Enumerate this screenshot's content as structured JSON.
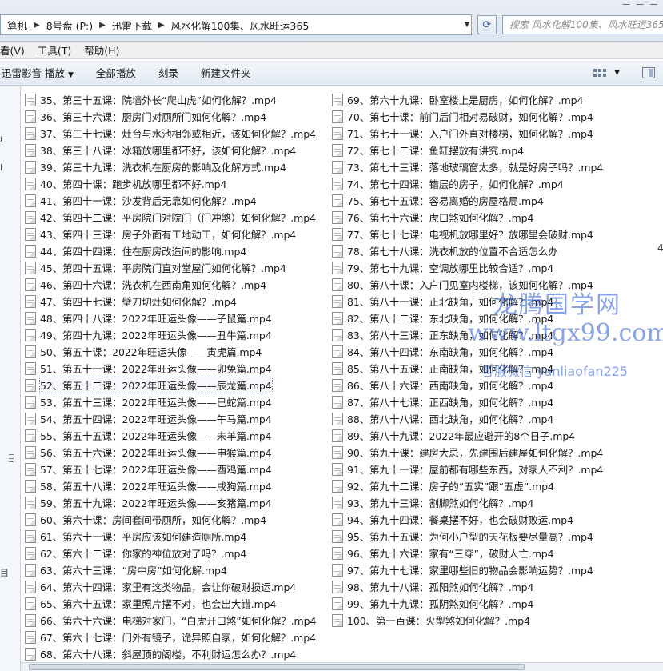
{
  "address_bar": {
    "crumbs": [
      "算机",
      "8号盘 (P:)",
      "迅雷下载",
      "风水化解100集、风水旺运365"
    ],
    "search_placeholder": "搜索 风水化解100集、风水旺运365"
  },
  "menu": [
    "看(V)",
    "工具(T)",
    "帮助(H)"
  ],
  "toolbar": {
    "buttons": [
      "迅雷影音 播放",
      "全部播放",
      "刻录",
      "新建文件夹"
    ]
  },
  "nav_glyphs": [
    "t",
    "I",
    "目"
  ],
  "files_left": [
    "35、第三十五课：院墙外长“爬山虎”如何化解？.mp4",
    "36、第三十六课：厨房门对厕所门如何化解？.mp4",
    "37、第三十七课：灶台与水池相邻或相近，该如何化解？.mp4",
    "38、第三十八课：冰箱放哪里都不好，该如何化解？.mp4",
    "39、第三十九课：洗衣机在厨房的影响及化解方式.mp4",
    "40、第四十课：跑步机放哪里都不好.mp4",
    "41、第四十一课：沙发背后无靠如何化解？.mp4",
    "42、第四十二课：平房院门对院门（门冲煞）如何化解？.mp4",
    "43、第四十三课：房子外面有工地动工，如何化解？.mp4",
    "44、第四十四课：住在厨房改造间的影响.mp4",
    "45、第四十五课：平房院门直对堂屋门如何化解？.mp4",
    "46、第四十六课：洗衣机在西南角如何化解？.mp4",
    "47、第四十七课：壁刀切灶如何化解？.mp4",
    "48、第四十八课：2022年旺运头像——子鼠篇.mp4",
    "49、第四十九课：2022年旺运头像——丑牛篇.mp4",
    "50、第五十课：2022年旺运头像——寅虎篇.mp4",
    "51、第五十一课：2022年旺运头像——卯兔篇.mp4",
    "52、第五十二课：2022年旺运头像——辰龙篇.mp4",
    "53、第五十三课：2022年旺运头像——巳蛇篇.mp4",
    "54、第五十四课：2022年旺运头像——午马篇.mp4",
    "55、第五十五课：2022年旺运头像——未羊篇.mp4",
    "56、第五十六课：2022年旺运头像——申猴篇.mp4",
    "57、第五十七课：2022年旺运头像——酉鸡篇.mp4",
    "58、第五十八课：2022年旺运头像——戌狗篇.mp4",
    "59、第五十九课：2022年旺运头像——亥猪篇.mp4",
    "60、第六十课：房间套间带厕所，如何化解？.mp4",
    "61、第六十一课：平房应该如何建造厕所.mp4",
    "62、第六十二课：你家的神位放对了吗？.mp4",
    "63、第六十三课：“房中房”如何化解.mp4",
    "64、第六十四课：家里有这类物品，会让你破财损运.mp4",
    "65、第六十五课：家里照片摆不对，也会出大错.mp4",
    "66、第六十六课：电梯对家门，“白虎开口煞”如何化解？.mp4",
    "67、第六十七课：门外有镜子，诡异照自家，如何化解？.mp4",
    "68、第六十八课：斜屋顶的阁楼，不利财运怎么办？.mp4"
  ],
  "files_right": [
    "69、第六十九课：卧室楼上是厨房，如何化解？.mp4",
    "70、第七十课：前门后门相对易破财，如何化解？.mp4",
    "71、第七十一课：入户门外直对楼梯，如何化解？.mp4",
    "72、第七十二课：鱼缸摆放有讲究.mp4",
    "73、第七十三课：落地玻璃窗太多，就是好房子吗？.mp4",
    "74、第七十四课：错层的房子，如何化解？.mp4",
    "75、第七十五课：容易离婚的房屋格局.mp4",
    "76、第七十六课：虎口煞如何化解？.mp4",
    "77、第七十七课：电视机放哪里好？放哪里会破财.mp4",
    "78、第七十八课：洗衣机放的位置不合适怎么办",
    "79、第七十九课：空调放哪里比较合适？.mp4",
    "80、第八十课：入户门见室内楼梯，该如何化解？.mp4",
    "81、第八十一课：正北缺角，如何化解？.mp4",
    "82、第八十二课：东北缺角，如何化解？.mp4",
    "83、第八十三课：正东缺角，如何化解？.mp4",
    "84、第八十四课：东南缺角，如何化解？.mp4",
    "85、第八十五课：正南缺角，如何化解？.mp4",
    "86、第八十六课：西南缺角，如何化解？.mp4",
    "87、第八十七课：正西缺角，如何化解？.mp4",
    "88、第八十八课：西北缺角，如何化解？.mp4",
    "89、第八十九课：2022年最应避开的8个日子.mp4",
    "90、第九十课：建房大忌，先建围后建屋如何化解？.mp4",
    "91、第九十一课：屋前都有哪些东西，对家人不利？.mp4",
    "92、第九十二课：房子的“五实”跟“五虚”.mp4",
    "93、第九十三课：割脚煞如何化解？.mp4",
    "94、第九十四课：餐桌摆不好，也会破财败运.mp4",
    "95、第九十五课：为何小户型的天花板要尽量高？.mp4",
    "96、第九十六课：家有“三穿”，破财人亡.mp4",
    "97、第九十七课：家里哪些旧的物品会影响运势？.mp4",
    "98、第九十八课：孤阳煞如何化解？.mp4",
    "99、第九十九课：孤阴煞如何化解？.mp4",
    "100、第一百课：火型煞如何化解？.mp4"
  ],
  "trailing_digit": "4",
  "watermark": {
    "line1": "龙腾国学网",
    "line2": "www.ltgx99.com",
    "line3": "客服微信 yanliaofan225"
  }
}
